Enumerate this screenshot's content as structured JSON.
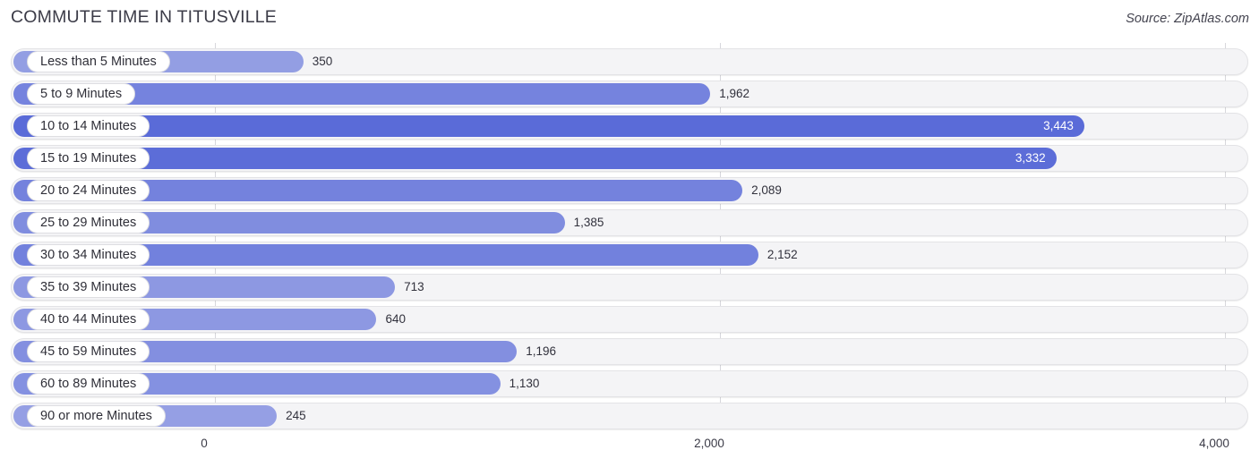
{
  "header": {
    "title": "COMMUTE TIME IN TITUSVILLE",
    "source": "Source: ZipAtlas.com"
  },
  "chart_data": {
    "type": "bar",
    "orientation": "horizontal",
    "title": "COMMUTE TIME IN TITUSVILLE",
    "xlabel": "",
    "ylabel": "",
    "xlim": [
      0,
      4000
    ],
    "grid": true,
    "legend": "none",
    "xticks": [
      {
        "value": 0,
        "label": "0"
      },
      {
        "value": 2000,
        "label": "2,000"
      },
      {
        "value": 4000,
        "label": "4,000"
      }
    ],
    "categories": [
      "Less than 5 Minutes",
      "5 to 9 Minutes",
      "10 to 14 Minutes",
      "15 to 19 Minutes",
      "20 to 24 Minutes",
      "25 to 29 Minutes",
      "30 to 34 Minutes",
      "35 to 39 Minutes",
      "40 to 44 Minutes",
      "45 to 59 Minutes",
      "60 to 89 Minutes",
      "90 or more Minutes"
    ],
    "values": [
      350,
      1962,
      3443,
      3332,
      2089,
      1385,
      2152,
      713,
      640,
      1196,
      1130,
      245
    ],
    "value_labels": [
      "350",
      "1,962",
      "3,443",
      "3,332",
      "2,089",
      "1,385",
      "2,152",
      "713",
      "640",
      "1,196",
      "1,130",
      "245"
    ],
    "bar_color": "#7d8ade",
    "track_color": "#f4f4f6",
    "grid_color": "#d7d7dc"
  }
}
